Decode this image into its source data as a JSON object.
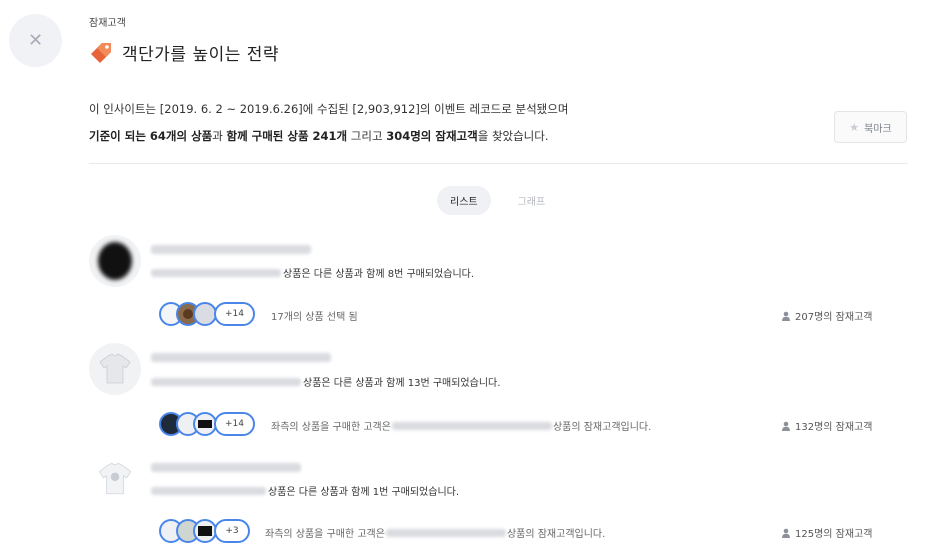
{
  "breadcrumb": "잠재고객",
  "title": "객단가를 높이는 전략",
  "summary": {
    "line1": "이 인사이트는 [2019. 6. 2 ~ 2019.6.26]에 수집된 [2,903,912]의 이벤트 레코드로 분석됐으며",
    "line2": {
      "p1": "기준이 되는  64개의 상품",
      "p2": "과 ",
      "p3": "함께 구매된 상품 241개",
      "p4": " 그리고 ",
      "p5": "304명의 잠재고객",
      "p6": "을 찾았습니다."
    }
  },
  "bookmark": {
    "label": "북마크",
    "icon": "star-icon"
  },
  "tabs": [
    {
      "label": "리스트",
      "active": true
    },
    {
      "label": "그래프",
      "active": false
    }
  ],
  "items": [
    {
      "purchase_text": "상품은 다른 상품과 함께 8번 구매되었습니다.",
      "more_count": "+14",
      "desc_pre": "17개의 상품 선택 됨",
      "desc_post": "",
      "customers": "207명의 잠재고객"
    },
    {
      "purchase_text": "상품은 다른 상품과 함께 13번 구매되었습니다.",
      "more_count": "+14",
      "desc_pre": "좌측의 상품을 구매한 고객은",
      "desc_post": "상품의 잠재고객입니다.",
      "customers": "132명의 잠재고객"
    },
    {
      "purchase_text": "상품은 다른 상품과 함께 1번 구매되었습니다.",
      "more_count": "+3",
      "desc_pre": "좌측의 상품을 구매한 고객은",
      "desc_post": "상품의 잠재고객입니다.",
      "customers": "125명의 잠재고객"
    }
  ],
  "colors": {
    "accent": "#4a86e8",
    "tag": "#e8623a"
  }
}
